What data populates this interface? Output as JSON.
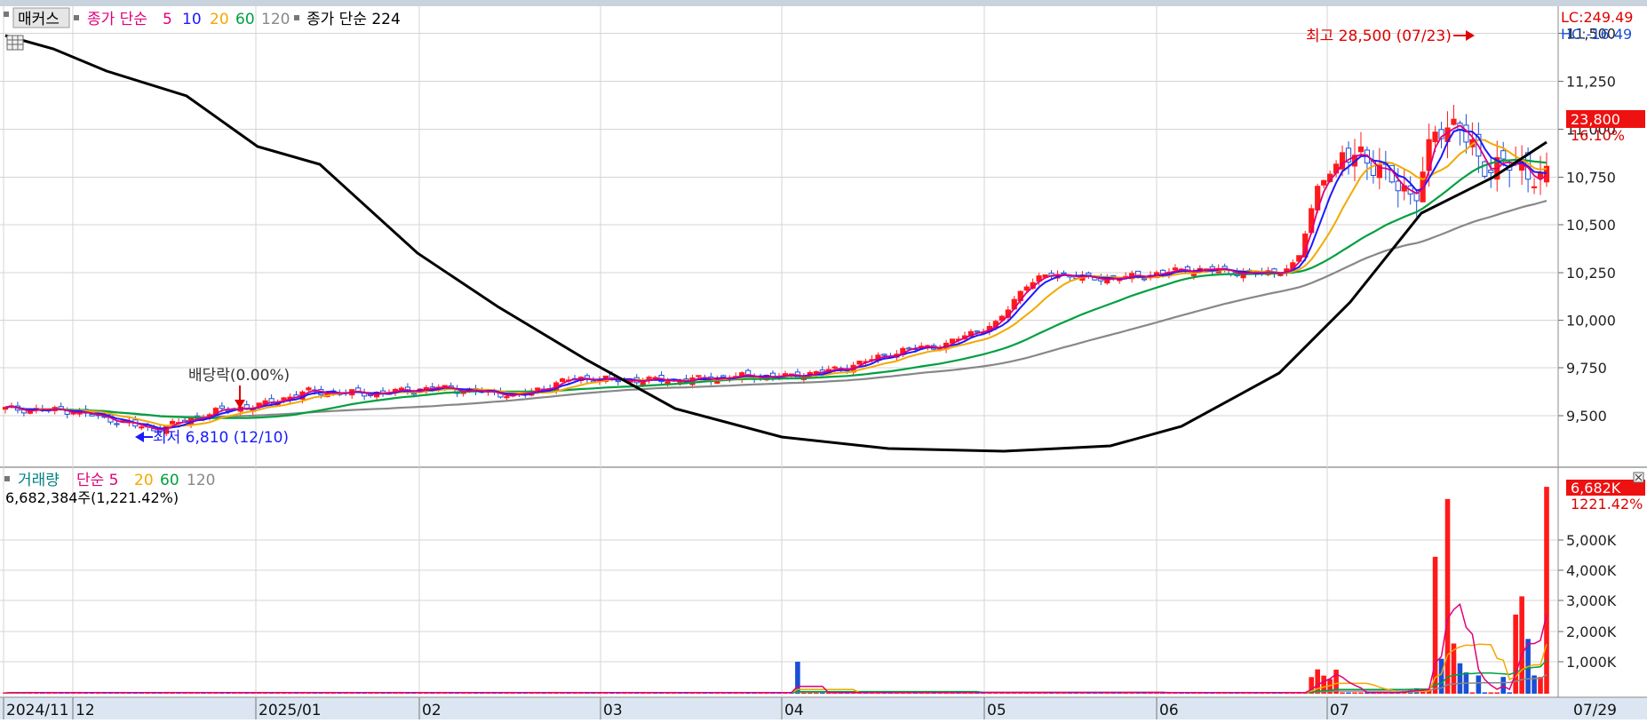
{
  "legend_price": {
    "items": [
      {
        "text": "매커스",
        "color": "#000000",
        "boxed": true
      },
      {
        "text": "종가 단순",
        "color": "#e0007a"
      },
      {
        "text": "5",
        "color": "#e0007a"
      },
      {
        "text": "10",
        "color": "#1a1aff"
      },
      {
        "text": "20",
        "color": "#f2a900"
      },
      {
        "text": "60",
        "color": "#00a040"
      },
      {
        "text": "120",
        "color": "#888888"
      },
      {
        "text": "종가 단순 224",
        "color": "#000000"
      }
    ]
  },
  "legend_volume": {
    "items": [
      {
        "text": "거래량",
        "color": "#008080"
      },
      {
        "text": "단순 5",
        "color": "#e0007a"
      },
      {
        "text": "20",
        "color": "#f2a900"
      },
      {
        "text": "60",
        "color": "#00a040"
      },
      {
        "text": "120",
        "color": "#888888"
      }
    ],
    "total_text": "6,682,384주(1,221.42%)"
  },
  "top_right": {
    "lc": "LC:249.49",
    "hc": "HC:-16.49"
  },
  "current_price": {
    "value": "23,800",
    "change": "16.10%"
  },
  "current_volume": {
    "value": "6,682K",
    "change": "1221.42%"
  },
  "annotations": {
    "high": "최고 28,500 (07/23)",
    "low": "최저 6,810 (12/10)",
    "dividend": "배당락(0.00%)"
  },
  "colors": {
    "up": "#ff1a1a",
    "down": "#1a4fd6",
    "ma5": "#e0007a",
    "ma10": "#1a1aff",
    "ma20": "#f2a900",
    "ma60": "#00a040",
    "ma120": "#888888",
    "ma224": "#000000",
    "grid": "#d4d4d4",
    "axis_bg": "#dbe6f2"
  },
  "chart_data": [
    {
      "type": "candlestick",
      "panel": "price",
      "y_ticks": [
        "11,500",
        "11,250",
        "11,000",
        "10,750",
        "10,500",
        "10,250",
        "10,000",
        "9,750",
        "9,500"
      ],
      "x_labels": [
        "2024/11",
        "12",
        "2025/01",
        "02",
        "03",
        "04",
        "05",
        "06",
        "07",
        "07/29"
      ],
      "series": [
        {
          "name": "종가 단순 5"
        },
        {
          "name": "10"
        },
        {
          "name": "20"
        },
        {
          "name": "60"
        },
        {
          "name": "120"
        },
        {
          "name": "종가 단순 224"
        }
      ]
    },
    {
      "type": "bar",
      "panel": "volume",
      "y_ticks": [
        "5,000K",
        "4,000K",
        "3,000K",
        "2,000K",
        "1,000K"
      ],
      "series": [
        {
          "name": "거래량"
        },
        {
          "name": "단순 5"
        },
        {
          "name": "20"
        },
        {
          "name": "60"
        },
        {
          "name": "120"
        }
      ]
    }
  ]
}
